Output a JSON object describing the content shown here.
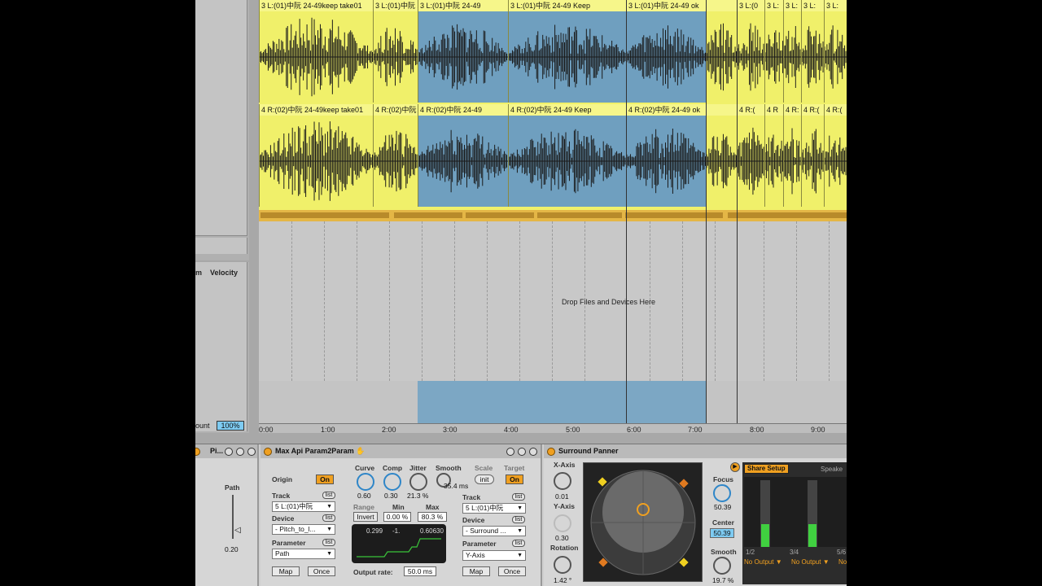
{
  "left_panel": {
    "velocity_prefix": "m",
    "velocity_label": "Velocity",
    "count_label": "ount",
    "count_value": "100%"
  },
  "tracks": {
    "lane1_clips": [
      {
        "label": "3 L:(01)中阮 24-49keep take01",
        "selected": false
      },
      {
        "label": "3 L:(01)中阮 24-",
        "selected": false
      },
      {
        "label": "3 L:(01)中阮 24-49",
        "selected": true
      },
      {
        "label": "3 L:(01)中阮 24-49 Keep",
        "selected": true
      },
      {
        "label": "3 L:(01)中阮 24-49 ok",
        "selected": true
      },
      {
        "label": "",
        "selected": false
      },
      {
        "label": "3 L:(0",
        "selected": false
      },
      {
        "label": "3 L:",
        "selected": false
      },
      {
        "label": "3 L:",
        "selected": false
      },
      {
        "label": "3 L:",
        "selected": false
      },
      {
        "label": "3 L:",
        "selected": false
      }
    ],
    "lane2_clips": [
      {
        "label": "4 R:(02)中阮 24-49keep take01",
        "selected": false
      },
      {
        "label": "4 R:(02)中阮 24",
        "selected": false
      },
      {
        "label": "4 R:(02)中阮 24-49",
        "selected": true
      },
      {
        "label": "4 R:(02)中阮 24-49 Keep",
        "selected": true
      },
      {
        "label": "4 R:(02)中阮 24-49 ok",
        "selected": true
      },
      {
        "label": "",
        "selected": false
      },
      {
        "label": "4 R:(",
        "selected": false
      },
      {
        "label": "4 R",
        "selected": false
      },
      {
        "label": "4 R:",
        "selected": false
      },
      {
        "label": "4 R:(",
        "selected": false
      },
      {
        "label": "4 R:(",
        "selected": false
      }
    ],
    "drop_text": "Drop Files and Devices Here"
  },
  "ruler": [
    "0:00",
    "1:00",
    "2:00",
    "3:00",
    "4:00",
    "5:00",
    "6:00",
    "7:00",
    "8:00",
    "9:00"
  ],
  "device_pitch": {
    "title": "Pi...",
    "path_label": "Path",
    "path_value": "0.20"
  },
  "device_max": {
    "title": "Max Api Param2Param",
    "origin_label": "Origin",
    "origin_on": "On",
    "target_label": "Target",
    "target_on": "On",
    "track_label": "Track",
    "list_label": "list",
    "track_value": "5 L:(01)中阮",
    "device_label": "Device",
    "device_value": "- Pitch_to_l...",
    "parameter_label": "Parameter",
    "parameter_value": "Path",
    "map_label": "Map",
    "once_label": "Once",
    "curve_label": "Curve",
    "curve_value": "0.60",
    "comp_label": "Comp",
    "comp_value": "0.30",
    "jitter_label": "Jitter",
    "jitter_value": "21.3 %",
    "smooth_label": "Smooth",
    "smooth_value": "35.4 ms",
    "scale_label": "Scale",
    "scale_value": "init",
    "range_label": "Range",
    "invert_label": "Invert",
    "min_label": "Min",
    "min_value": "0.00 %",
    "max_label": "Max",
    "max_value": "80.3 %",
    "graph_v1": "0.299",
    "graph_v2": "-1.",
    "graph_v3": "0.60630",
    "output_rate_label": "Output rate:",
    "output_rate_value": "50.0 ms",
    "t_track_value": "5 L:(01)中阮",
    "t_device_value": "- Surround ...",
    "t_parameter_value": "Y-Axis"
  },
  "device_surround": {
    "title": "Surround Panner",
    "xaxis_label": "X-Axis",
    "xaxis_value": "0.01",
    "yaxis_label": "Y-Axis",
    "yaxis_value": "0.30",
    "rotation_label": "Rotation",
    "rotation_value": "1.42 °",
    "focus_label": "Focus",
    "focus_value": "50.39",
    "center_label": "Center",
    "center_value": "50.39",
    "smooth_label": "Smooth",
    "smooth_value": "19.7 %",
    "share_setup": "Share Setup",
    "speakers": "Speake",
    "ch1": "1/2",
    "ch2": "3/4",
    "ch3": "5/6",
    "out1": "No Output",
    "out2": "No Output",
    "out3": "No"
  },
  "colors": {
    "clip_yellow": "#f0f06a",
    "selection_blue": "#6f9fbf",
    "accent_orange": "#f0a020"
  }
}
